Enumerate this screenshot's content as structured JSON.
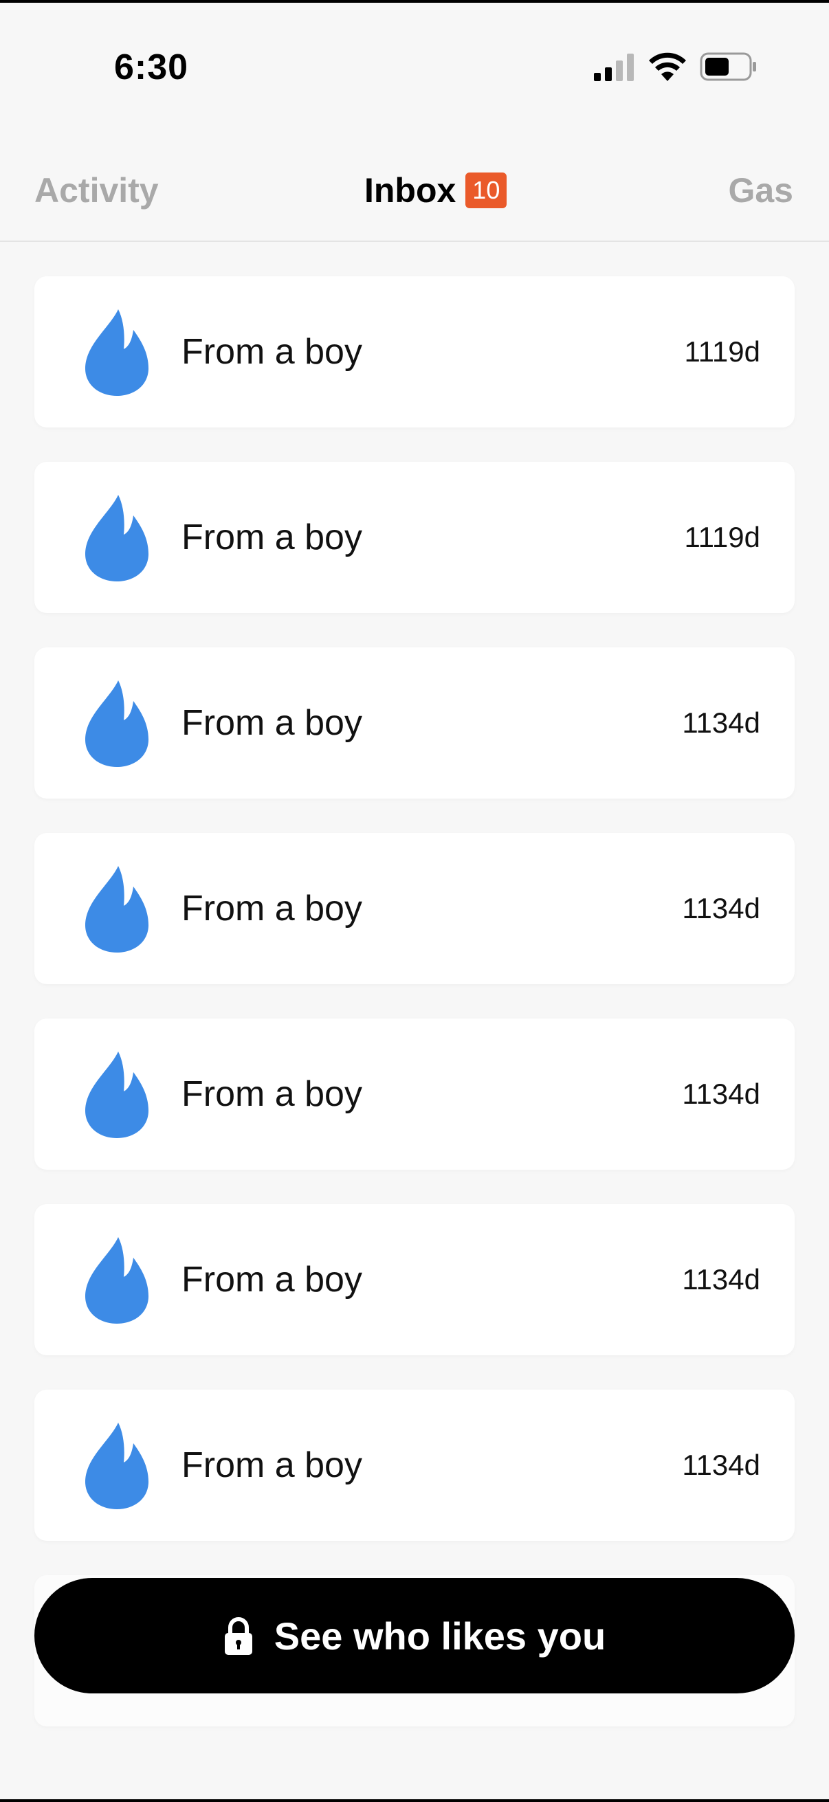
{
  "status_bar": {
    "time": "6:30",
    "icons": [
      "signal-icon",
      "wifi-icon",
      "battery-icon"
    ]
  },
  "tabs": {
    "activity": "Activity",
    "inbox": "Inbox",
    "inbox_badge": "10",
    "gas": "Gas",
    "active": "inbox"
  },
  "items": [
    {
      "label": "From a boy",
      "time": "1119d",
      "icon": "flame-icon"
    },
    {
      "label": "From a boy",
      "time": "1119d",
      "icon": "flame-icon"
    },
    {
      "label": "From a boy",
      "time": "1134d",
      "icon": "flame-icon"
    },
    {
      "label": "From a boy",
      "time": "1134d",
      "icon": "flame-icon"
    },
    {
      "label": "From a boy",
      "time": "1134d",
      "icon": "flame-icon"
    },
    {
      "label": "From a boy",
      "time": "1134d",
      "icon": "flame-icon"
    },
    {
      "label": "From a boy",
      "time": "1134d",
      "icon": "flame-icon"
    }
  ],
  "cta": {
    "label": "See who likes you",
    "icon": "lock-icon"
  },
  "colors": {
    "background": "#f7f7f7",
    "card": "#ffffff",
    "flame": "#3d8be6",
    "badge": "#ea5a2a",
    "inactive_tab": "#a9a9a9",
    "cta": "#000000"
  }
}
